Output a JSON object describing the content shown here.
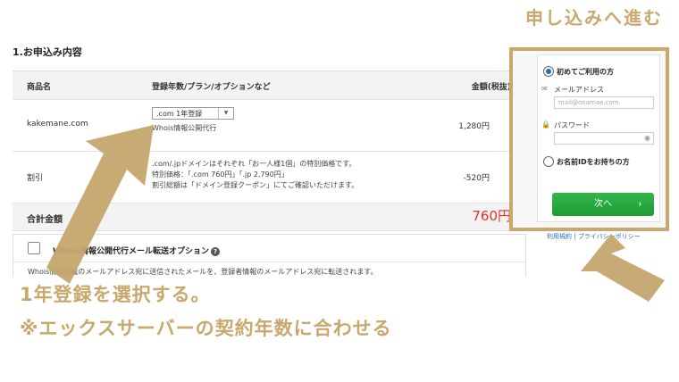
{
  "section": {
    "title": "1.お申込み内容"
  },
  "table": {
    "headers": {
      "product": "商品名",
      "plan": "登録年数/プラン/オプションなど",
      "price": "金額(税抜)"
    },
    "domain_row": {
      "name": "kakemane.com",
      "select_value": ".com 1年登録",
      "whois": "Whois情報公開代行",
      "price": "1,280円"
    },
    "discount_row": {
      "name": "割引",
      "notes": [
        ".com/.jpドメインはそれぞれ「お一人様1個」の特別価格です。",
        "特別価格：「.com 760円」「.jp 2,790円」",
        "割引総額は「ドメイン登録クーポン」にてご確認いただけます。"
      ],
      "price": "-520円"
    },
    "total_row": {
      "label": "合計金額",
      "price": "760円"
    }
  },
  "option": {
    "label": "Whois情報公開代行メール転送オプション",
    "help": "?",
    "description": "Whois情報記載のメールアドレス宛に送信されたメールを、登録者情報のメールアドレス宛に転送されます。"
  },
  "login_panel": {
    "heading": "申し込みへ進む",
    "first_time_label": "初めてご利用の方",
    "email_label": "メールアドレス",
    "email_placeholder": "mail@onamae.com",
    "password_label": "パスワード",
    "existing_label": "お名前IDをお持ちの方",
    "next_button": "次へ",
    "next_chevron": "›",
    "footer_links": "利用規約 | プライバシーポリシー"
  },
  "annotation": {
    "line1": "1年登録を選択する。",
    "line2": "※エックスサーバーの契約年数に合わせる"
  },
  "colors": {
    "accent": "#c9a76d",
    "total_price": "#e0322b",
    "button": "#1e9c37",
    "link": "#2b6bc4"
  },
  "icons": [
    "help-icon",
    "mail-icon",
    "lock-icon",
    "eye-icon",
    "chevron-right-icon",
    "arrow-up-left",
    "arrow-up"
  ]
}
